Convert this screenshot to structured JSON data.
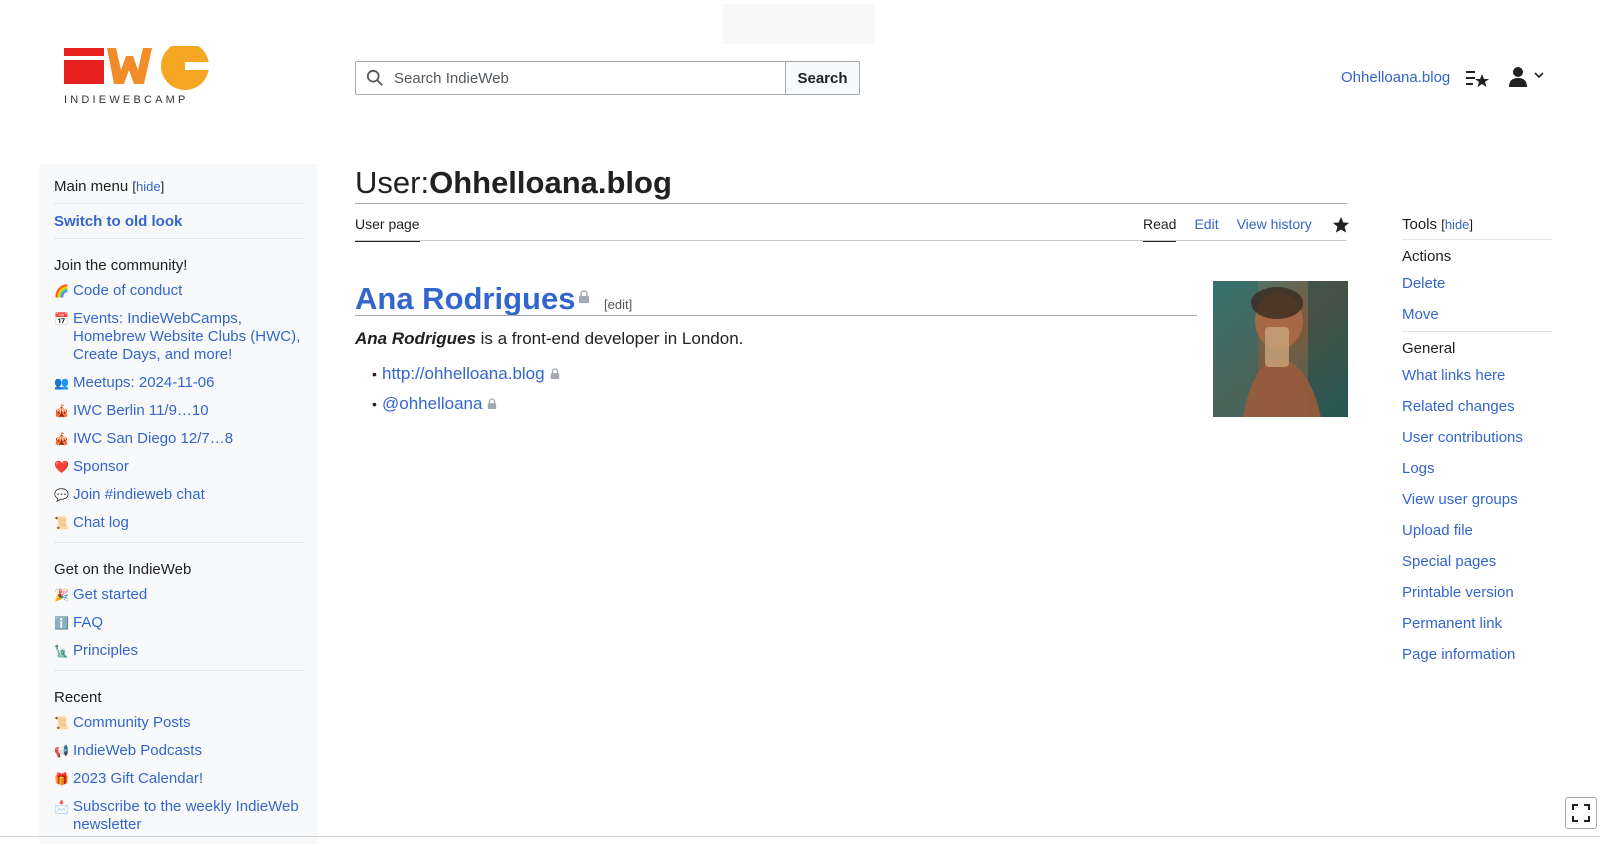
{
  "header": {
    "logo_text": "INDIEWEBCAMP",
    "search_placeholder": "Search IndieWeb",
    "search_button": "Search",
    "user_link": "Ohhelloana.blog",
    "watchlist_icon": "watchlist-icon",
    "user_icon": "user-icon"
  },
  "sidebar": {
    "main_menu": "Main menu",
    "hide": "hide",
    "switch_label": "Switch to old look",
    "join_heading": "Join the community!",
    "join_items": [
      {
        "emoji": "🌈",
        "label": "Code of conduct"
      },
      {
        "emoji": "📅",
        "label": "Events: IndieWebCamps, Homebrew Website Clubs (HWC), Create Days, and more!"
      },
      {
        "emoji": "👥",
        "label": "Meetups: 2024-11-06"
      },
      {
        "emoji": "🎪",
        "label": "IWC Berlin 11/9…10"
      },
      {
        "emoji": "🎪",
        "label": "IWC San Diego 12/7…8"
      },
      {
        "emoji": "❤️",
        "label": "Sponsor"
      },
      {
        "emoji": "💬",
        "label": "Join #indieweb chat"
      },
      {
        "emoji": "📜",
        "label": "Chat log"
      }
    ],
    "get_heading": "Get on the IndieWeb",
    "get_items": [
      {
        "emoji": "🎉",
        "label": "Get started"
      },
      {
        "emoji": "ℹ️",
        "label": "FAQ"
      },
      {
        "emoji": "🗽",
        "label": "Principles"
      }
    ],
    "recent_heading": "Recent",
    "recent_items": [
      {
        "emoji": "📜",
        "label": "Community Posts"
      },
      {
        "emoji": "📢",
        "label": "IndieWeb Podcasts"
      },
      {
        "emoji": "🎁",
        "label": "2023 Gift Calendar!"
      },
      {
        "emoji": "📩",
        "label": "Subscribe to the weekly IndieWeb newsletter"
      }
    ]
  },
  "page": {
    "title_ns": "User:",
    "title_name": "Ohhelloana.blog",
    "tab_userpage": "User page",
    "tab_read": "Read",
    "tab_edit": "Edit",
    "tab_history": "View history",
    "heading": "Ana Rodrigues",
    "edit_label": "[edit]",
    "intro_name": "Ana Rodrigues",
    "intro_rest": " is a front-end developer in London.",
    "links": [
      "http://ohhelloana.blog",
      "@ohhelloana"
    ]
  },
  "tools": {
    "title": "Tools",
    "hide": "hide",
    "actions_heading": "Actions",
    "actions": [
      "Delete",
      "Move"
    ],
    "general_heading": "General",
    "general": [
      "What links here",
      "Related changes",
      "User contributions",
      "Logs",
      "View user groups",
      "Upload file",
      "Special pages",
      "Printable version",
      "Permanent link",
      "Page information"
    ]
  },
  "colors": {
    "link": "#3366cc",
    "logo_red": "#e8231f",
    "logo_orange": "#f5a623",
    "sidebar_bg": "#f8f9fa"
  }
}
